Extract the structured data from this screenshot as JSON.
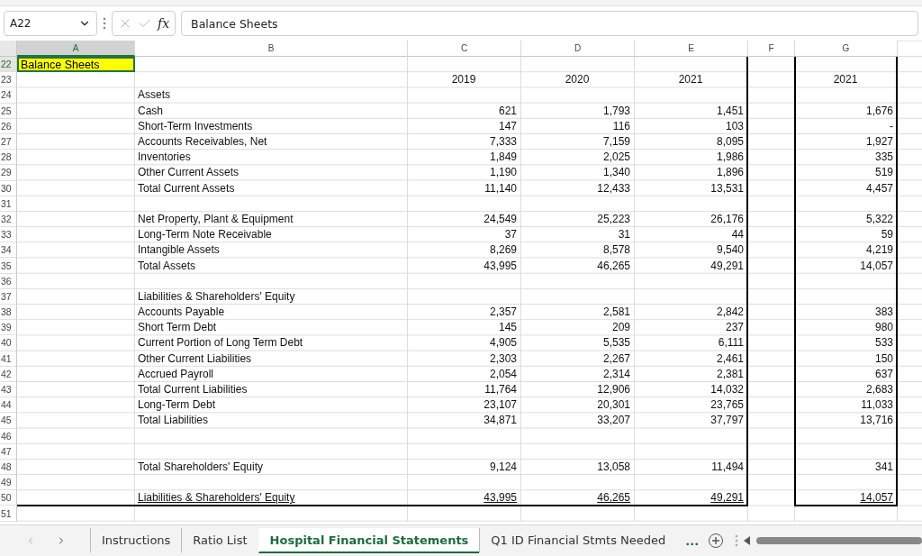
{
  "formula_bar": {
    "name_box": "A22",
    "function_label": "fx",
    "value": "Balance Sheets"
  },
  "columns": [
    {
      "letter": "A",
      "selected": true
    },
    {
      "letter": "B",
      "selected": false
    },
    {
      "letter": "C",
      "selected": false
    },
    {
      "letter": "D",
      "selected": false
    },
    {
      "letter": "E",
      "selected": false
    },
    {
      "letter": "F",
      "selected": false
    },
    {
      "letter": "G",
      "selected": false
    }
  ],
  "rows": [
    {
      "num": "22",
      "kind": "title",
      "a": "Balance Sheets"
    },
    {
      "num": "23",
      "kind": "header",
      "c": "2019",
      "d": "2020",
      "e": "2021",
      "g": "2021"
    },
    {
      "num": "24",
      "kind": "item",
      "b": "Assets"
    },
    {
      "num": "25",
      "kind": "item",
      "b": "Cash",
      "c": "621",
      "d": "1,793",
      "e": "1,451",
      "g": "1,676"
    },
    {
      "num": "26",
      "kind": "item",
      "b": "Short-Term Investments",
      "c": "147",
      "d": "116",
      "e": "103",
      "g": "-"
    },
    {
      "num": "27",
      "kind": "item",
      "b": "Accounts Receivables, Net",
      "c": "7,333",
      "d": "7,159",
      "e": "8,095",
      "g": "1,927"
    },
    {
      "num": "28",
      "kind": "item",
      "b": "Inventories",
      "c": "1,849",
      "d": "2,025",
      "e": "1,986",
      "g": "335"
    },
    {
      "num": "29",
      "kind": "item",
      "b": "Other Current Assets",
      "c": "1,190",
      "d": "1,340",
      "e": "1,896",
      "g": "519"
    },
    {
      "num": "30",
      "kind": "item",
      "b": "Total Current Assets",
      "c": "11,140",
      "d": "12,433",
      "e": "13,531",
      "g": "4,457"
    },
    {
      "num": "31",
      "kind": "item"
    },
    {
      "num": "32",
      "kind": "item",
      "b": "Net Property, Plant & Equipment",
      "c": "24,549",
      "d": "25,223",
      "e": "26,176",
      "g": "5,322"
    },
    {
      "num": "33",
      "kind": "item",
      "b": "Long-Term Note Receivable",
      "c": "37",
      "d": "31",
      "e": "44",
      "g": "59"
    },
    {
      "num": "34",
      "kind": "item",
      "b": "Intangible Assets",
      "c": "8,269",
      "d": "8,578",
      "e": "9,540",
      "g": "4,219"
    },
    {
      "num": "35",
      "kind": "item",
      "b": "Total Assets",
      "c": "43,995",
      "d": "46,265",
      "e": "49,291",
      "g": "14,057"
    },
    {
      "num": "36",
      "kind": "item"
    },
    {
      "num": "37",
      "kind": "item",
      "b": "Liabilities & Shareholders' Equity"
    },
    {
      "num": "38",
      "kind": "item",
      "b": "Accounts Payable",
      "c": "2,357",
      "d": "2,581",
      "e": "2,842",
      "g": "383"
    },
    {
      "num": "39",
      "kind": "item",
      "b": "Short Term Debt",
      "c": "145",
      "d": "209",
      "e": "237",
      "g": "980"
    },
    {
      "num": "40",
      "kind": "item",
      "b": "Current Portion of Long Term Debt",
      "c": "4,905",
      "d": "5,535",
      "e": "6,111",
      "g": "533"
    },
    {
      "num": "41",
      "kind": "item",
      "b": "Other Current Liabilities",
      "c": "2,303",
      "d": "2,267",
      "e": "2,461",
      "g": "150"
    },
    {
      "num": "42",
      "kind": "item",
      "b": "Accrued Payroll",
      "c": "2,054",
      "d": "2,314",
      "e": "2,381",
      "g": "637"
    },
    {
      "num": "43",
      "kind": "item",
      "b": "Total Current Liabilities",
      "c": "11,764",
      "d": "12,906",
      "e": "14,032",
      "g": "2,683"
    },
    {
      "num": "44",
      "kind": "item",
      "b": "Long-Term Debt",
      "c": "23,107",
      "d": "20,301",
      "e": "23,765",
      "g": "11,033"
    },
    {
      "num": "45",
      "kind": "item",
      "b": "Total Liabilities",
      "c": "34,871",
      "d": "33,207",
      "e": "37,797",
      "g": "13,716"
    },
    {
      "num": "46",
      "kind": "item"
    },
    {
      "num": "47",
      "kind": "item"
    },
    {
      "num": "48",
      "kind": "item",
      "b": "Total Shareholders' Equity",
      "c": "9,124",
      "d": "13,058",
      "e": "11,494",
      "g": "341"
    },
    {
      "num": "49",
      "kind": "item"
    },
    {
      "num": "50",
      "kind": "total",
      "b": "Liabilities & Shareholders' Equity",
      "c": "43,995",
      "d": "46,265",
      "e": "49,291",
      "g": "14,057"
    },
    {
      "num": "51",
      "kind": "item"
    }
  ],
  "sheet_tabs": [
    {
      "label": "Instructions",
      "selected": false
    },
    {
      "label": "Ratio List",
      "selected": false
    },
    {
      "label": "Hospital Financial Statements",
      "selected": true
    },
    {
      "label": "Q1  ID Financial Stmts Needed",
      "selected": false
    }
  ],
  "more_tabs": "..."
}
